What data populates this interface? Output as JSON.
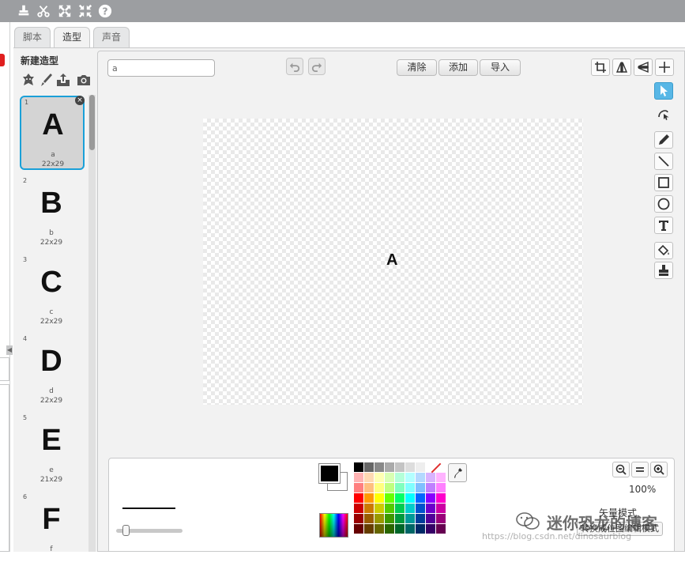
{
  "topbar": {
    "icons": [
      "stamp-icon",
      "scissors-icon",
      "grow-icon",
      "shrink-icon",
      "help-icon"
    ]
  },
  "tabs": [
    {
      "label": "脚本",
      "active": false
    },
    {
      "label": "造型",
      "active": true
    },
    {
      "label": "声音",
      "active": false
    }
  ],
  "costume_panel": {
    "new_costume_label": "新建造型",
    "new_costume_icons": [
      "sprite-library-icon",
      "paint-brush-icon",
      "upload-icon",
      "camera-icon"
    ],
    "items": [
      {
        "num": "1",
        "glyph": "A",
        "name": "a",
        "size": "22x29",
        "selected": true
      },
      {
        "num": "2",
        "glyph": "B",
        "name": "b",
        "size": "22x29",
        "selected": false
      },
      {
        "num": "3",
        "glyph": "C",
        "name": "c",
        "size": "22x29",
        "selected": false
      },
      {
        "num": "4",
        "glyph": "D",
        "name": "d",
        "size": "22x29",
        "selected": false
      },
      {
        "num": "5",
        "glyph": "E",
        "name": "e",
        "size": "21x29",
        "selected": false
      },
      {
        "num": "6",
        "glyph": "F",
        "name": "f",
        "size": "",
        "selected": false
      }
    ]
  },
  "editor": {
    "costume_name_value": "a",
    "buttons": {
      "clear": "清除",
      "add": "添加",
      "import": "导入"
    },
    "canvas_text": "A",
    "zoom_level": "100%",
    "mode_label": "矢量模式",
    "convert_button": "转换成位图编辑模式"
  },
  "colors": {
    "accent": "#1aa0d8",
    "active_tool": "#58b7e6",
    "primary": "#000000",
    "secondary": "#ffffff",
    "palette": [
      "#000000",
      "#666666",
      "#888888",
      "#aaaaaa",
      "#c4c4c4",
      "#dddddd",
      "#eeeeee",
      "#ffffff",
      "none",
      "#ffb3b3",
      "#ffd9b3",
      "#ffffb3",
      "#d9ffb3",
      "#b3ffd9",
      "#b3ffff",
      "#b3d9ff",
      "#d9b3ff",
      "#ffb3ff",
      "#ff7f7f",
      "#ffbf7f",
      "#ffff7f",
      "#bfff7f",
      "#7fffbf",
      "#7fffff",
      "#7fbfff",
      "#bf7fff",
      "#ff7fff",
      "#ff0000",
      "#ff9900",
      "#ffff00",
      "#66ff00",
      "#00ff66",
      "#00ffff",
      "#0066ff",
      "#8800ff",
      "#ff00cc",
      "#cc0000",
      "#cc7a00",
      "#cccc00",
      "#52cc00",
      "#00cc52",
      "#00cccc",
      "#0052cc",
      "#6d00cc",
      "#cc00a3",
      "#990000",
      "#995c00",
      "#999900",
      "#3d9900",
      "#00993d",
      "#009999",
      "#003d99",
      "#520099",
      "#99007a",
      "#660000",
      "#663d00",
      "#666600",
      "#296600",
      "#006629",
      "#006666",
      "#002966",
      "#360066",
      "#660051"
    ]
  },
  "watermark": {
    "title": "迷你恐龙的博客",
    "url": "https://blog.csdn.net/dinosaurblog"
  }
}
